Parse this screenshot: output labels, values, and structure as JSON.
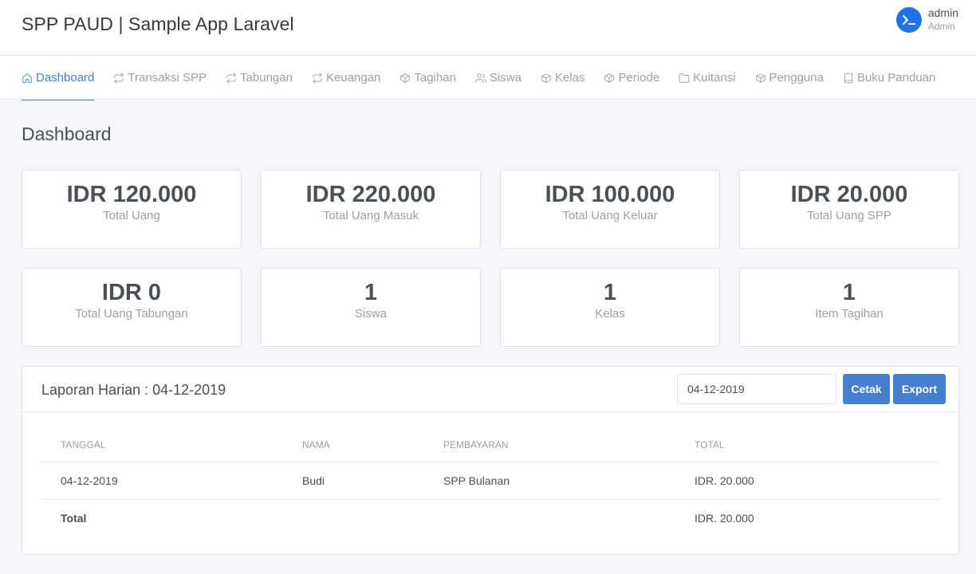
{
  "app": {
    "title": "SPP PAUD | Sample App Laravel"
  },
  "user": {
    "name": "admin",
    "role": "Admin",
    "avatar_icon": "terminal-icon",
    "avatar_color": "#1e74e6"
  },
  "nav": [
    {
      "label": "Dashboard",
      "icon": "home-icon",
      "active": true
    },
    {
      "label": "Transaksi SPP",
      "icon": "repeat-icon"
    },
    {
      "label": "Tabungan",
      "icon": "repeat-icon"
    },
    {
      "label": "Keuangan",
      "icon": "repeat-icon"
    },
    {
      "label": "Tagihan",
      "icon": "box-icon"
    },
    {
      "label": "Siswa",
      "icon": "users-icon"
    },
    {
      "label": "Kelas",
      "icon": "box-icon"
    },
    {
      "label": "Periode",
      "icon": "box-icon"
    },
    {
      "label": "Kuitansi",
      "icon": "folder-icon"
    },
    {
      "label": "Pengguna",
      "icon": "box-icon"
    },
    {
      "label": "Buku Panduan",
      "icon": "book-icon"
    }
  ],
  "page_title": "Dashboard",
  "stats": [
    {
      "value": "IDR 120.000",
      "label": "Total Uang"
    },
    {
      "value": "IDR 220.000",
      "label": "Total Uang Masuk"
    },
    {
      "value": "IDR 100.000",
      "label": "Total Uang Keluar"
    },
    {
      "value": "IDR 20.000",
      "label": "Total Uang SPP"
    },
    {
      "value": "IDR 0",
      "label": "Total Uang Tabungan"
    },
    {
      "value": "1",
      "label": "Siswa"
    },
    {
      "value": "1",
      "label": "Kelas"
    },
    {
      "value": "1",
      "label": "Item Tagihan"
    }
  ],
  "report": {
    "title": "Laporan Harian : 04-12-2019",
    "date_value": "04-12-2019",
    "print_label": "Cetak",
    "export_label": "Export",
    "columns": [
      "TANGGAL",
      "NAMA",
      "PEMBAYARAN",
      "TOTAL"
    ],
    "rows": [
      {
        "tanggal": "04-12-2019",
        "nama": "Budi",
        "pembayaran": "SPP Bulanan",
        "total": "IDR. 20.000"
      }
    ],
    "total_label": "Total",
    "total_value": "IDR. 20.000"
  },
  "colors": {
    "accent": "#467fcf",
    "muted": "#9aa0ac",
    "text": "#495057",
    "background": "#f4f6fa"
  }
}
